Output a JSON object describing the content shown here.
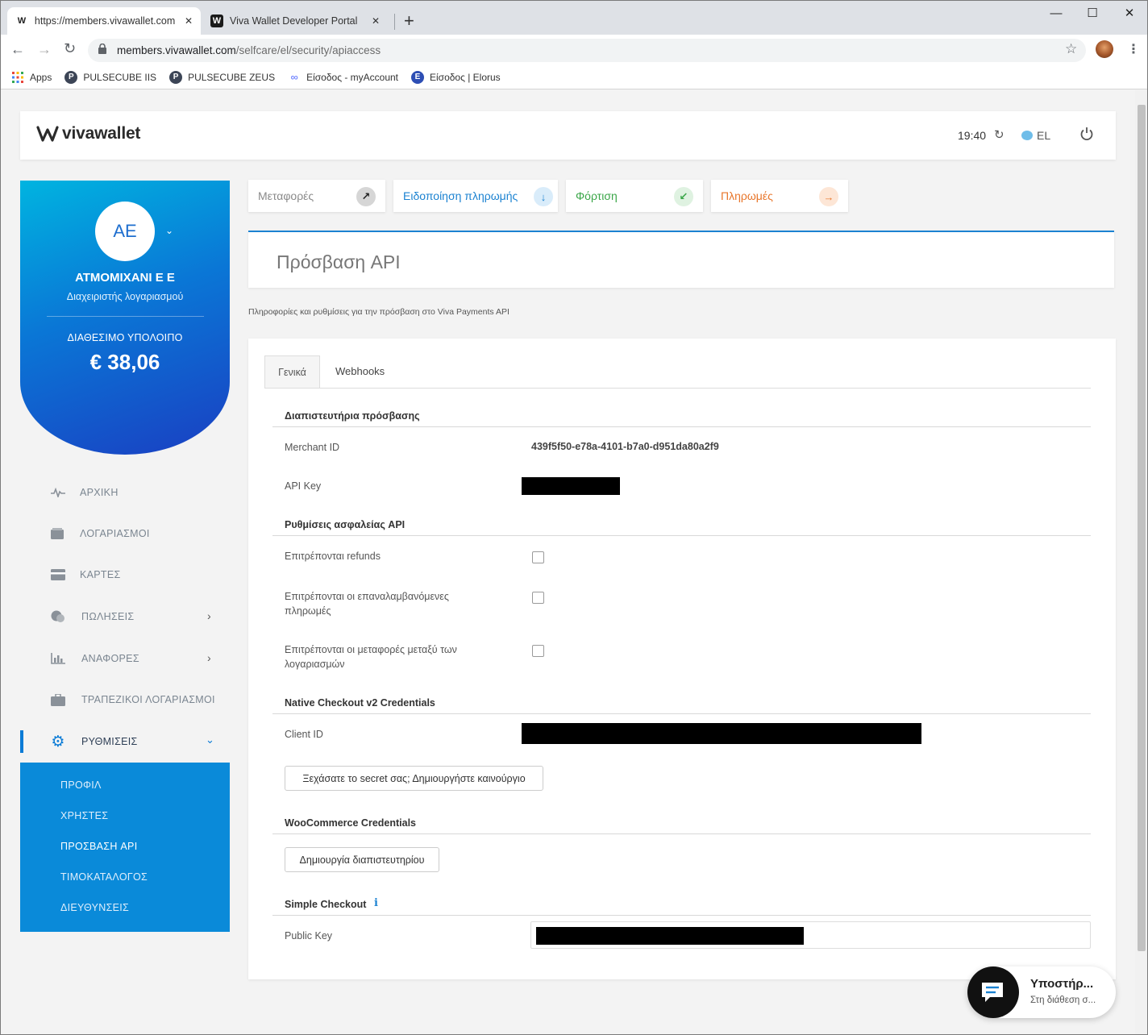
{
  "browser": {
    "tabs": [
      {
        "title": "https://members.vivawallet.com/",
        "close": "✕"
      },
      {
        "title": "Viva Wallet Developer Portal",
        "close": "✕"
      }
    ],
    "new_tab": "+",
    "url_host": "members.vivawallet.com",
    "url_path": "/selfcare/el/security/apiaccess",
    "bookmarks": [
      {
        "label": "Apps",
        "icon": "apps-grid-icon",
        "color": "#e8453c"
      },
      {
        "label": "PULSECUBE IIS",
        "icon": "pulsecube-icon",
        "color": "#3c4556"
      },
      {
        "label": "PULSECUBE ZEUS",
        "icon": "pulsecube-icon",
        "color": "#3c4556"
      },
      {
        "label": "Είσοδος - myAccount",
        "icon": "myaccount-icon",
        "color": "#7a8cff"
      },
      {
        "label": "Είσοδος | Elorus",
        "icon": "elorus-icon",
        "color": "#2d4eb4"
      }
    ]
  },
  "header": {
    "logo": "vivawallet",
    "time": "19:40",
    "language": "EL"
  },
  "account": {
    "initials": "AE",
    "name": "ΑΤΜΟΜΙΧΑΝΙ Ε Ε",
    "role": "Διαχειριστής λογαριασμού",
    "balance_label": "ΔΙΑΘΕΣΙΜΟ ΥΠΟΛΟΙΠΟ",
    "balance": "€ 38,06"
  },
  "nav": {
    "items": [
      {
        "label": "ΑΡΧΙΚΗ",
        "icon": "activity-icon"
      },
      {
        "label": "ΛΟΓΑΡΙΑΣΜΟΙ",
        "icon": "wallet-icon"
      },
      {
        "label": "ΚΑΡΤΕΣ",
        "icon": "card-icon"
      },
      {
        "label": "ΠΩΛΗΣΕΙΣ",
        "icon": "sales-icon"
      },
      {
        "label": "ΑΝΑΦΟΡΕΣ",
        "icon": "reports-icon"
      },
      {
        "label": "ΤΡΑΠΕΖΙΚΟΙ ΛΟΓΑΡΙΑΣΜΟΙ",
        "icon": "briefcase-icon"
      },
      {
        "label": "ΡΥΘΜΙΣΕΙΣ",
        "icon": "gear-icon"
      }
    ],
    "subitems": [
      "ΠΡΟΦΙΛ",
      "ΧΡΗΣΤΕΣ",
      "ΠΡΟΣΒΑΣΗ API",
      "ΤΙΜΟΚΑΤΑΛΟΓΟΣ",
      "ΔΙΕΥΘΥΝΣΕΙΣ"
    ]
  },
  "quick_actions": [
    {
      "label": "Μεταφορές",
      "icon": "arrow-up-right-icon",
      "color": "#8a8a8a"
    },
    {
      "label": "Ειδοποίηση πληρωμής",
      "icon": "arrow-down-icon",
      "color": "#1b82d1"
    },
    {
      "label": "Φόρτιση",
      "icon": "arrow-down-left-icon",
      "color": "#3aa648"
    },
    {
      "label": "Πληρωμές",
      "icon": "arrow-right-icon",
      "color": "#e8762b"
    }
  ],
  "page": {
    "title": "Πρόσβαση API",
    "subtitle": "Πληροφορίες και ρυθμίσεις για την πρόσβαση στο Viva Payments API",
    "tabs": [
      "Γενικά",
      "Webhooks"
    ],
    "credentials_title": "Διαπιστευτήρια πρόσβασης",
    "merchant_id_label": "Merchant ID",
    "merchant_id": "439f5f50-e78a-4101-b7a0-d951da80a2f9",
    "api_key_label": "API Key",
    "security_title": "Ρυθμίσεις ασφαλείας API",
    "security_options": [
      "Επιτρέπονται refunds",
      "Επιτρέπονται οι επαναλαμβανόμενες πληρωμές",
      "Επιτρέπονται οι μεταφορές μεταξύ των λογαριασμών"
    ],
    "native_title": "Native Checkout v2 Credentials",
    "client_id_label": "Client ID",
    "forgot_secret_button": "Ξεχάσατε το secret σας; Δημιουργήστε καινούργιο",
    "woo_title": "WooCommerce Credentials",
    "create_credential_button": "Δημιουργία διαπιστευτηρίου",
    "simple_title": "Simple Checkout",
    "public_key_label": "Public Key"
  },
  "support": {
    "title": "Υποστήρ...",
    "subtitle": "Στη διάθεση σ..."
  }
}
